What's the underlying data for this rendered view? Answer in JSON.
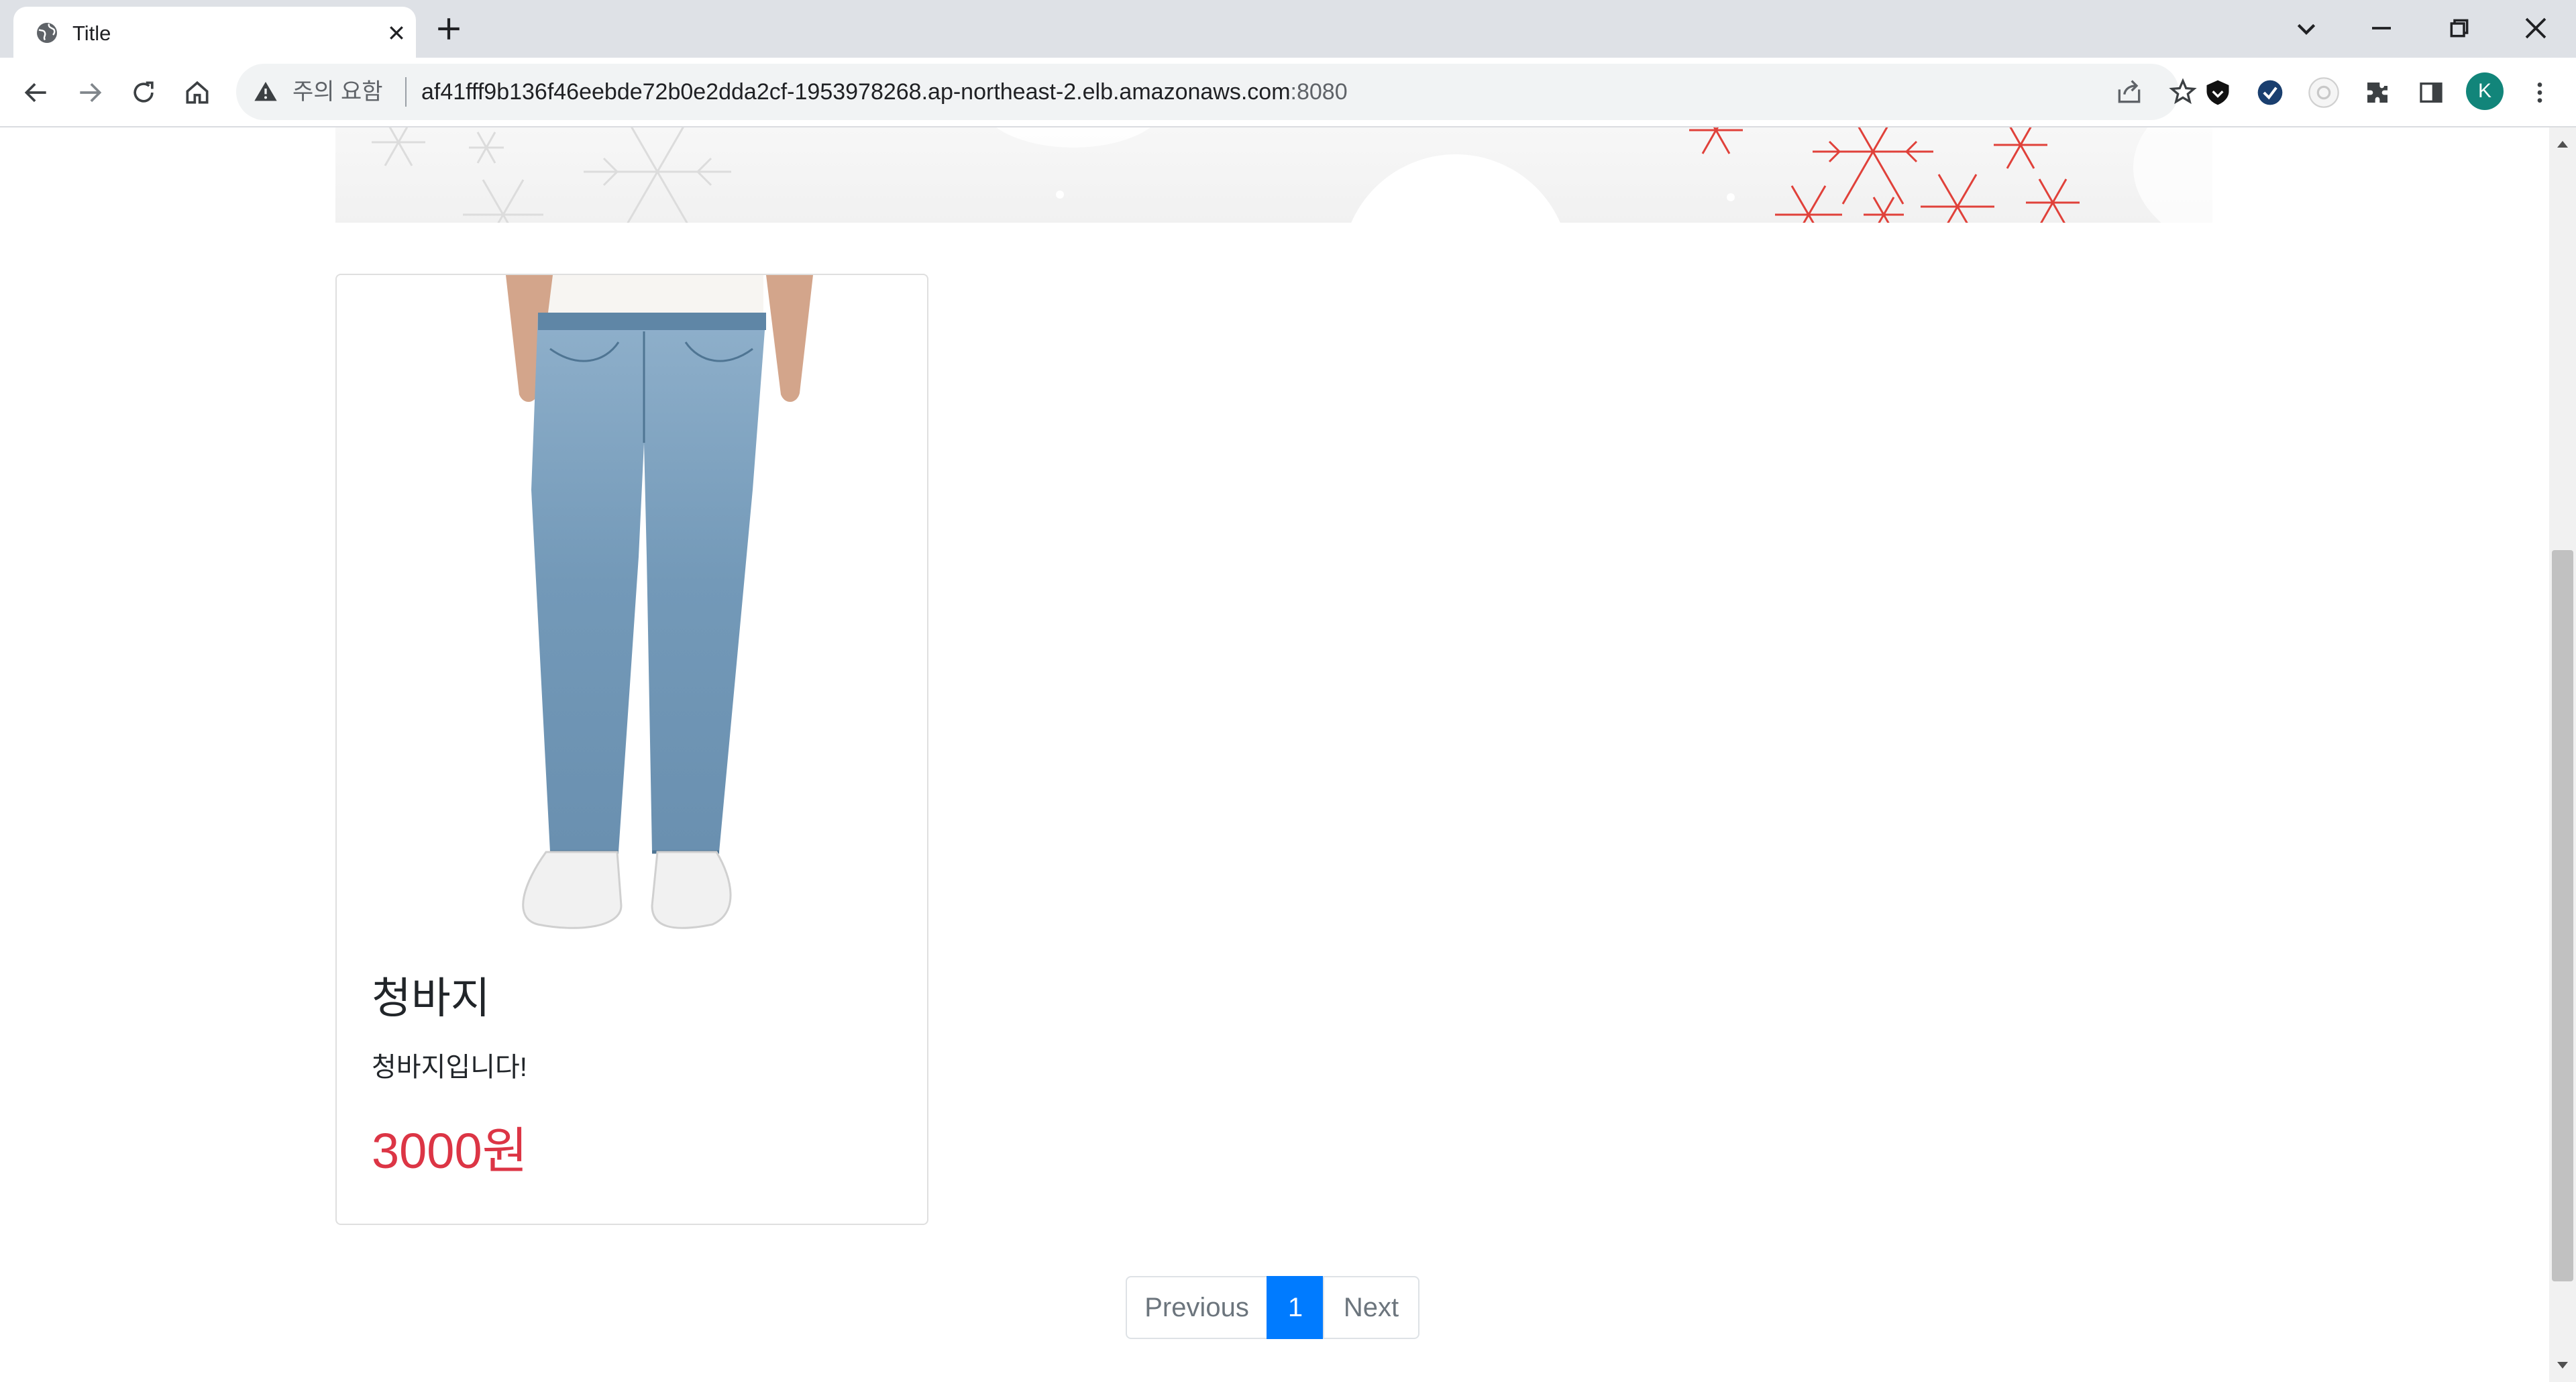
{
  "browser": {
    "tab": {
      "title": "Title"
    },
    "omnibox": {
      "security_label": "주의 요함",
      "url_host": "af41fff9b136f46eebde72b0e2dda2cf-1953978268.ap-northeast-2.elb.amazonaws.com",
      "url_port": ":8080"
    },
    "profile_initial": "K",
    "icons": {
      "back": "arrow-left-icon",
      "forward": "arrow-right-icon",
      "reload": "reload-icon",
      "home": "home-icon",
      "share": "share-icon",
      "bookmark": "star-icon",
      "extensions": "puzzle-icon",
      "side_panel": "side-panel-icon",
      "menu": "kebab-menu-icon"
    }
  },
  "product": {
    "name": "청바지",
    "description": "청바지입니다!",
    "price": "3000원",
    "image_alt": "jeans-photo"
  },
  "pagination": {
    "previous": "Previous",
    "current": "1",
    "next": "Next"
  },
  "colors": {
    "accent": "#007bff",
    "price": "#dc3545",
    "avatar": "#12857a",
    "tabstrip": "#dee1e6"
  }
}
